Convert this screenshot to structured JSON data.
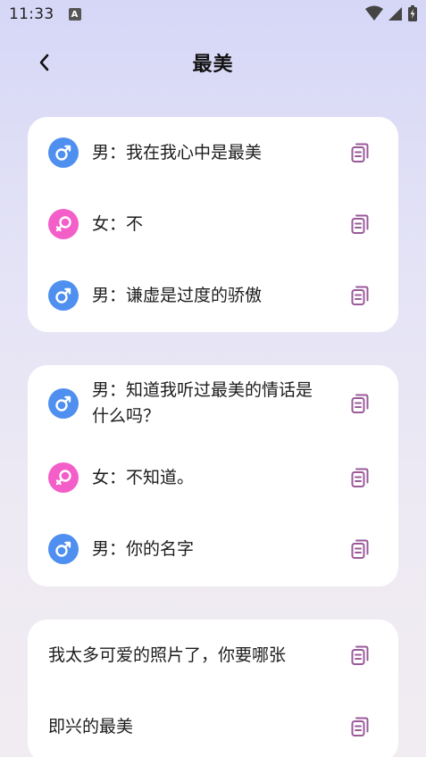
{
  "status_bar": {
    "time": "11:33",
    "notification": "A"
  },
  "header": {
    "title": "最美"
  },
  "cards": [
    {
      "lines": [
        {
          "gender": "male",
          "text": "男：我在我心中是最美"
        },
        {
          "gender": "female",
          "text": "女：不"
        },
        {
          "gender": "male",
          "text": "男：谦虚是过度的骄傲"
        }
      ]
    },
    {
      "lines": [
        {
          "gender": "male",
          "text": "男：知道我听过最美的情话是什么吗？"
        },
        {
          "gender": "female",
          "text": "女：不知道。"
        },
        {
          "gender": "male",
          "text": "男：你的名字"
        }
      ]
    },
    {
      "lines": [
        {
          "gender": "",
          "text": "我太多可爱的照片了，你要哪张"
        },
        {
          "gender": "",
          "text": "即兴的最美"
        }
      ]
    }
  ],
  "colors": {
    "male": "#4e8ff0",
    "female": "#f35ec9",
    "copy_icon": "#9a5a9a"
  },
  "icons": {
    "male": "male-symbol-icon",
    "female": "female-symbol-icon",
    "copy": "copy-icon",
    "back": "chevron-left-icon"
  }
}
